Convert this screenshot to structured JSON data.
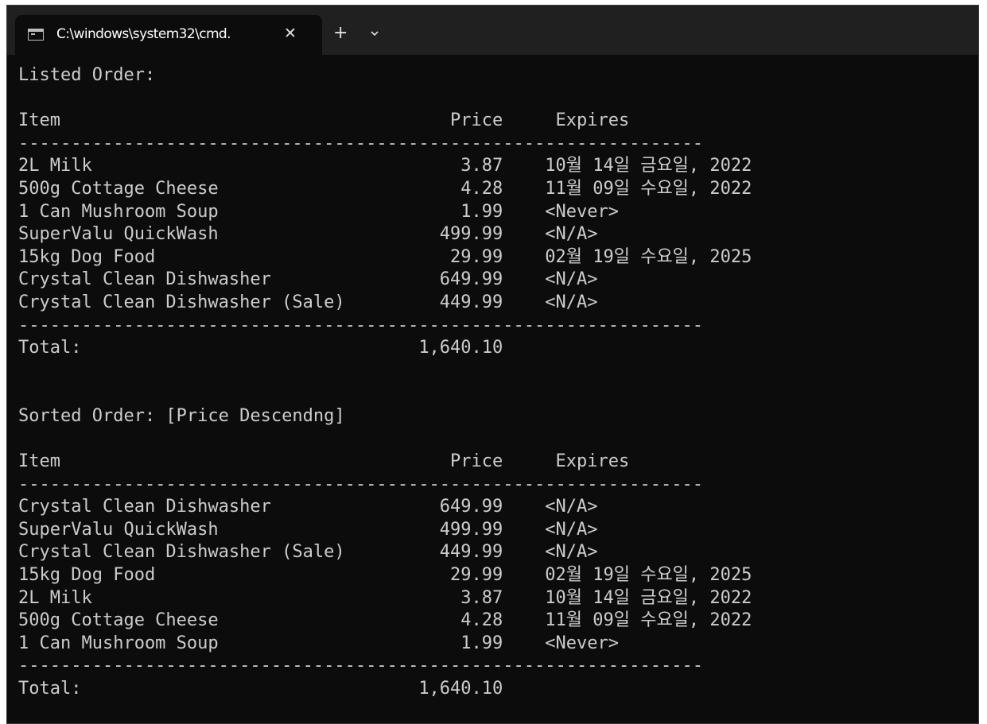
{
  "tab": {
    "icon": "terminal-icon",
    "title": "C:\\windows\\system32\\cmd.",
    "close_glyph": "✕",
    "new_tab_glyph": "+",
    "dropdown_icon": "chevron-down-icon"
  },
  "colors": {
    "window_bg": "#0c0c0c",
    "tabbar_bg": "#202020",
    "text": "#cccccc"
  },
  "terminal": {
    "lines": [
      "Listed Order:",
      "",
      "Item                                     Price     Expires",
      "-----------------------------------------------------------------",
      "2L Milk                                   3.87    10월 14일 금요일, 2022",
      "500g Cottage Cheese                       4.28    11월 09일 수요일, 2022",
      "1 Can Mushroom Soup                       1.99    <Never>",
      "SuperValu QuickWash                     499.99    <N/A>",
      "15kg Dog Food                            29.99    02월 19일 수요일, 2025",
      "Crystal Clean Dishwasher                649.99    <N/A>",
      "Crystal Clean Dishwasher (Sale)         449.99    <N/A>",
      "-----------------------------------------------------------------",
      "Total:                                1,640.10",
      "",
      "",
      "Sorted Order: [Price Descendng]",
      "",
      "Item                                     Price     Expires",
      "-----------------------------------------------------------------",
      "Crystal Clean Dishwasher                649.99    <N/A>",
      "SuperValu QuickWash                     499.99    <N/A>",
      "Crystal Clean Dishwasher (Sale)         449.99    <N/A>",
      "15kg Dog Food                            29.99    02월 19일 수요일, 2025",
      "2L Milk                                   3.87    10월 14일 금요일, 2022",
      "500g Cottage Cheese                       4.28    11월 09일 수요일, 2022",
      "1 Can Mushroom Soup                       1.99    <Never>",
      "-----------------------------------------------------------------",
      "Total:                                1,640.10"
    ]
  }
}
